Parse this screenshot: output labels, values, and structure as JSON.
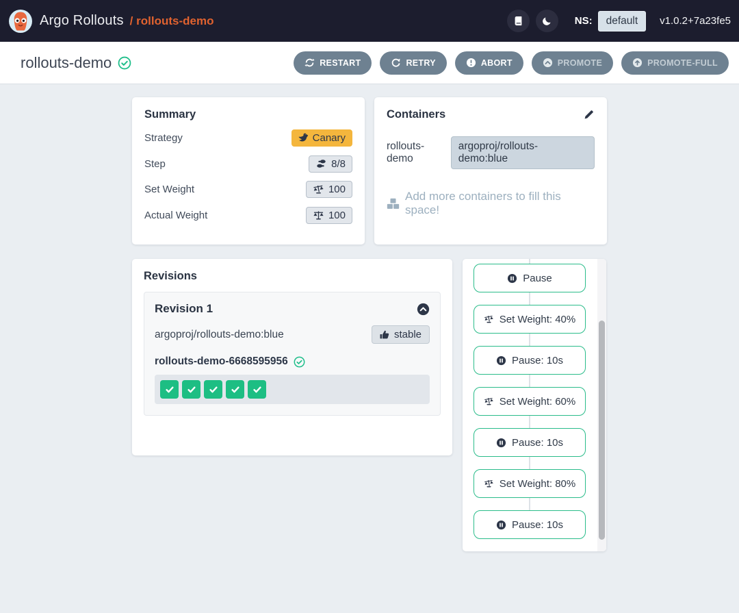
{
  "topbar": {
    "brand": "Argo Rollouts",
    "breadcrumb": "/ rollouts-demo",
    "ns_label": "NS:",
    "ns_value": "default",
    "version": "v1.0.2+7a23fe5"
  },
  "header": {
    "title": "rollouts-demo",
    "status": "healthy",
    "actions": [
      {
        "label": "RESTART",
        "icon": "sync-icon",
        "enabled": true
      },
      {
        "label": "RETRY",
        "icon": "redo-icon",
        "enabled": true
      },
      {
        "label": "ABORT",
        "icon": "exclamation-circle-icon",
        "enabled": true
      },
      {
        "label": "PROMOTE",
        "icon": "chevron-circle-up-icon",
        "enabled": false
      },
      {
        "label": "PROMOTE-FULL",
        "icon": "arrow-circle-up-icon",
        "enabled": false
      }
    ]
  },
  "summary": {
    "title": "Summary",
    "rows": [
      {
        "label": "Strategy",
        "value": "Canary",
        "icon": "canary-bird-icon",
        "style": "canary"
      },
      {
        "label": "Step",
        "value": "8/8",
        "icon": "shoe-prints-icon",
        "style": "default"
      },
      {
        "label": "Set Weight",
        "value": "100",
        "icon": "balance-scale-right-icon",
        "style": "default"
      },
      {
        "label": "Actual Weight",
        "value": "100",
        "icon": "balance-scale-icon",
        "style": "default"
      }
    ]
  },
  "containers": {
    "title": "Containers",
    "rows": [
      {
        "name": "rollouts-demo",
        "image": "argoproj/rollouts-demo:blue"
      }
    ],
    "empty_hint": "Add more containers to fill this space!"
  },
  "revisions": {
    "title": "Revisions",
    "items": [
      {
        "name": "Revision 1",
        "image": "argoproj/rollouts-demo:blue",
        "badge": "stable",
        "replicaset": "rollouts-demo-6668595956",
        "replicaset_status": "healthy",
        "pods": 5
      }
    ]
  },
  "steps": {
    "items": [
      {
        "label": "Pause",
        "icon": "pause-icon"
      },
      {
        "label": "Set Weight: 40%",
        "icon": "weight-icon"
      },
      {
        "label": "Pause: 10s",
        "icon": "pause-icon"
      },
      {
        "label": "Set Weight: 60%",
        "icon": "weight-icon"
      },
      {
        "label": "Pause: 10s",
        "icon": "pause-icon"
      },
      {
        "label": "Set Weight: 80%",
        "icon": "weight-icon"
      },
      {
        "label": "Pause: 10s",
        "icon": "pause-icon"
      }
    ]
  },
  "colors": {
    "topbar_bg": "#1c1d2e",
    "accent_orange": "#e0622f",
    "button_slate": "#6e8191",
    "canary_amber": "#f4b63d",
    "success_green": "#1dbe83",
    "page_bg": "#eaeef2"
  }
}
